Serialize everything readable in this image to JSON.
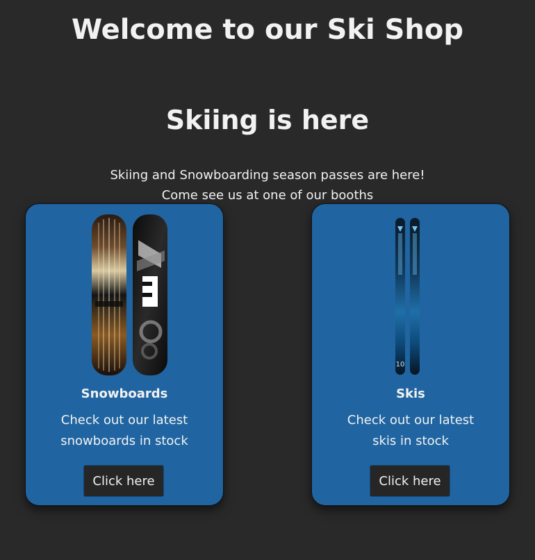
{
  "header": {
    "title": "Welcome to our Ski Shop"
  },
  "hero": {
    "title": "Skiing is here",
    "lines": [
      "Skiing and Snowboarding season passes are here!",
      "Come see us at one of our booths"
    ]
  },
  "cards": [
    {
      "title": "Snowboards",
      "text": "Check out our latest snowboards in stock",
      "button_label": "Click here",
      "image_icon": "snowboards-image"
    },
    {
      "title": "Skis",
      "text": "Check out our latest skis in stock",
      "button_label": "Click here",
      "image_icon": "skis-image"
    }
  ],
  "colors": {
    "background": "#292929",
    "card": "#2065a1",
    "button": "#262626",
    "text": "#f2f2f2"
  }
}
